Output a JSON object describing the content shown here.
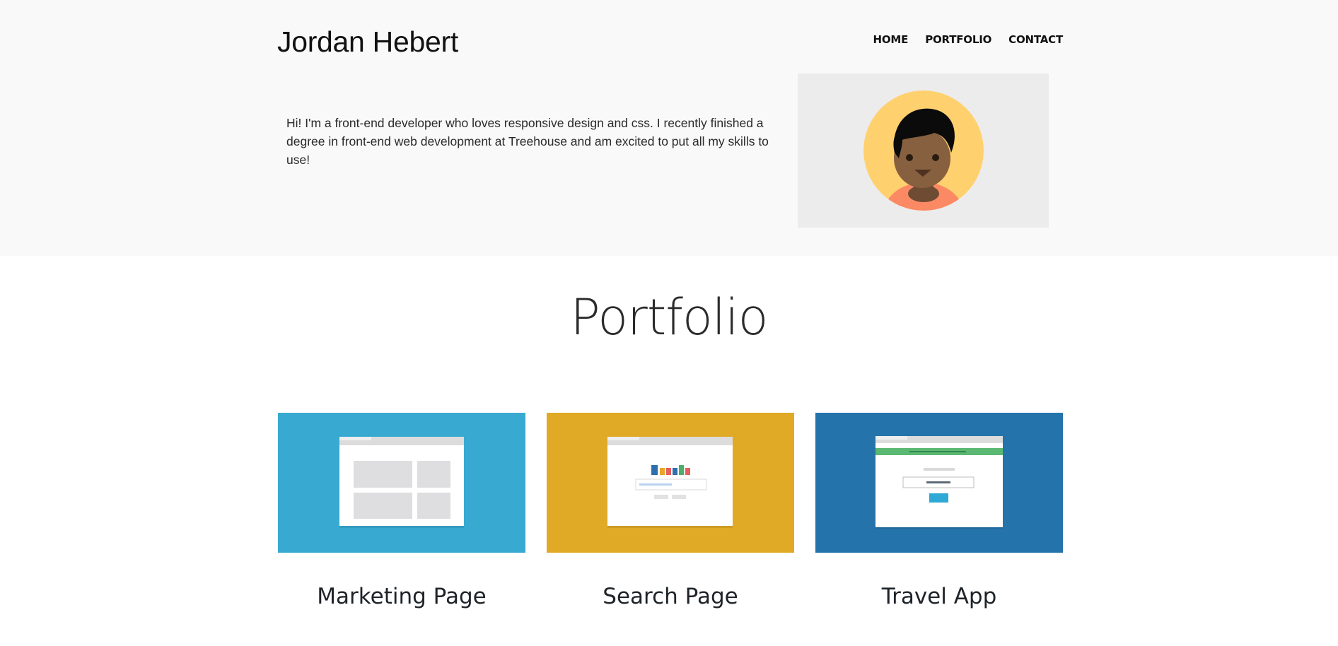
{
  "header": {
    "site_name": "Jordan Hebert",
    "nav": [
      {
        "label": "HOME"
      },
      {
        "label": "PORTFOLIO"
      },
      {
        "label": "CONTACT"
      }
    ]
  },
  "intro": {
    "text": "Hi! I'm a front-end developer who loves responsive design and css. I recently finished a degree in front-end web development at Treehouse and am excited to put all my skills to use!"
  },
  "avatar": {
    "icon": "avatar-illustration",
    "background_color": "#ffd16e",
    "frame_color": "#ececec"
  },
  "portfolio": {
    "heading": "Portfolio",
    "projects": [
      {
        "title": "Marketing Page",
        "thumb_color": "#38aad1",
        "icon": "marketing-page-thumbnail"
      },
      {
        "title": "Search Page",
        "thumb_color": "#e0aa26",
        "icon": "search-page-thumbnail"
      },
      {
        "title": "Travel App",
        "thumb_color": "#2573ab",
        "icon": "travel-app-thumbnail"
      }
    ]
  }
}
